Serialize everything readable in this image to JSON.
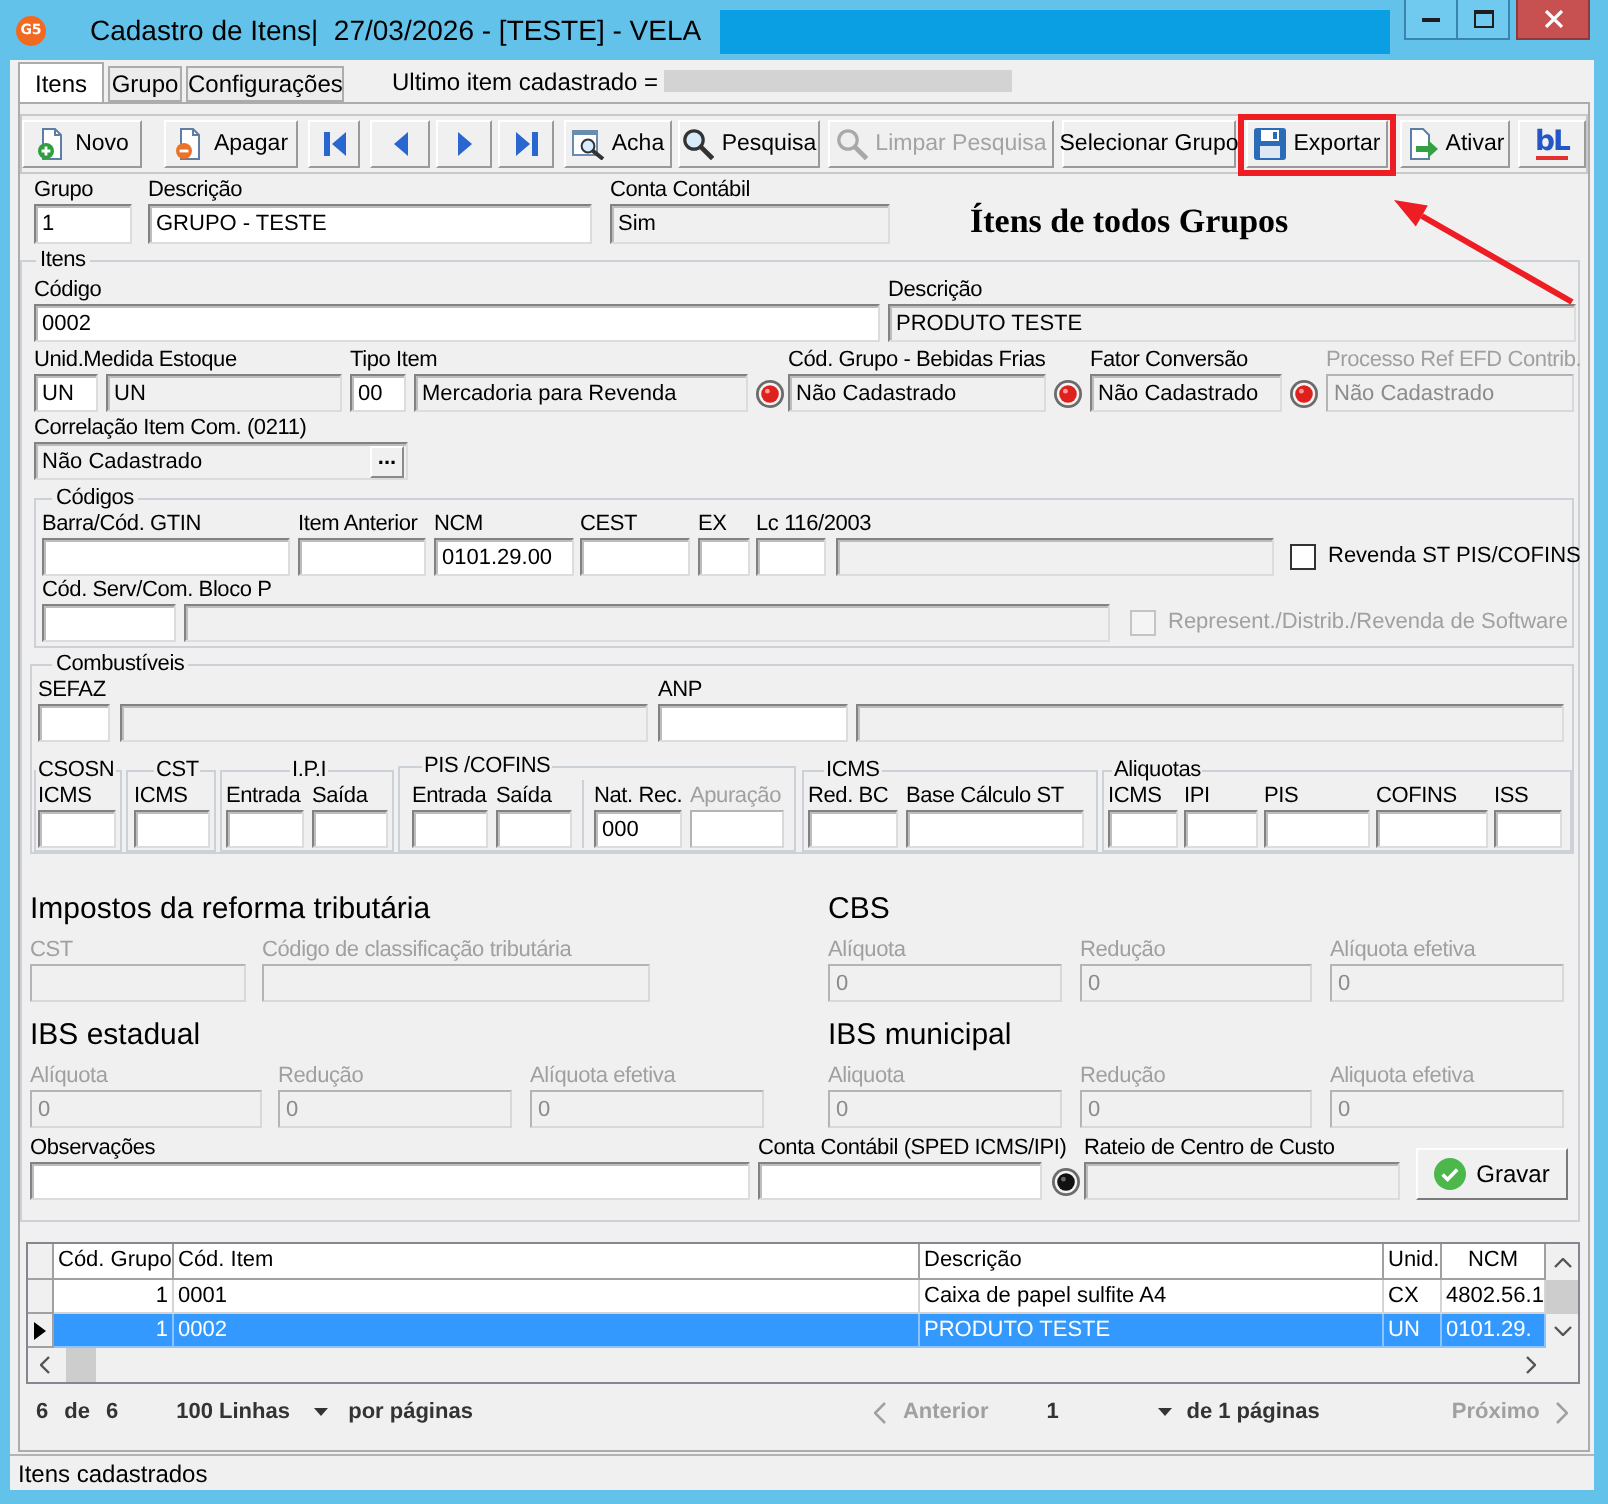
{
  "window": {
    "logo": "G5",
    "title": "Cadastro de Itens|  27/03/2026 - [TESTE] - VELA"
  },
  "tabs": [
    {
      "label": "Itens",
      "selected": true
    },
    {
      "label": "Grupo",
      "selected": false
    },
    {
      "label": "Configurações",
      "selected": false
    }
  ],
  "last_item": {
    "label": "Ultimo item cadastrado ="
  },
  "toolbar": [
    {
      "kind": "button",
      "label": "Novo",
      "disabled": false,
      "highlighted": false
    },
    {
      "kind": "button",
      "label": "Apagar",
      "disabled": false,
      "highlighted": false
    },
    {
      "kind": "nav",
      "disabled": false,
      "highlighted": false
    },
    {
      "kind": "nav",
      "disabled": false,
      "highlighted": false
    },
    {
      "kind": "nav",
      "disabled": false,
      "highlighted": false
    },
    {
      "kind": "nav",
      "disabled": false,
      "highlighted": false
    },
    {
      "kind": "button",
      "label": "Acha",
      "disabled": false,
      "highlighted": false
    },
    {
      "kind": "button",
      "label": "Pesquisa",
      "disabled": false,
      "highlighted": false
    },
    {
      "kind": "button",
      "label": "Limpar Pesquisa",
      "disabled": true,
      "highlighted": false
    },
    {
      "kind": "text",
      "label": "Selecionar Grupo",
      "disabled": false,
      "highlighted": false
    },
    {
      "kind": "button",
      "label": "Exportar",
      "disabled": false,
      "highlighted": true
    },
    {
      "kind": "button",
      "label": "Ativar",
      "disabled": false,
      "highlighted": false
    },
    {
      "kind": "logo",
      "label": "bL",
      "disabled": false,
      "highlighted": false
    }
  ],
  "annotation": {
    "note": "Ítens de todos Grupos"
  },
  "header": [
    {
      "label": "Grupo",
      "value": "1",
      "readonly": false,
      "disabled": false
    },
    {
      "label": "Descrição",
      "value": "GRUPO - TESTE",
      "readonly": false,
      "disabled": false
    },
    {
      "label": "Conta Contábil",
      "value": "Sim",
      "readonly": true,
      "disabled": false
    }
  ],
  "itens": {
    "title": "Itens",
    "row1": [
      {
        "label": "Código",
        "value": "0002",
        "readonly": false,
        "disabled": false
      },
      {
        "label": "Descrição",
        "value": "PRODUTO TESTE",
        "readonly": true,
        "disabled": false
      }
    ],
    "row2": [
      {
        "label": "Unid.Medida Estoque",
        "value": "UN",
        "readonly": false,
        "disabled": false
      },
      {
        "value": "UN",
        "readonly": true,
        "disabled": false
      },
      {
        "label": "Tipo Item",
        "value": "00",
        "readonly": false,
        "disabled": false
      },
      {
        "value": "Mercadoria para Revenda",
        "readonly": true,
        "disabled": false
      },
      {
        "label": "Cód. Grupo - Bebidas Frias",
        "value": "Não Cadastrado",
        "readonly": true,
        "disabled": false
      },
      {
        "label": "Fator Conversão",
        "value": "Não Cadastrado",
        "readonly": true,
        "disabled": false
      },
      {
        "label": "Processo Ref EFD Contrib.",
        "value": "Não Cadastrado",
        "readonly": true,
        "disabled": true
      }
    ],
    "correlation": {
      "label": "Correlação Item Com. (0211)",
      "value": "Não Cadastrado",
      "readonly": true,
      "disabled": false,
      "button": "..."
    },
    "codigos": {
      "title": "Códigos",
      "row1": [
        {
          "label": "Barra/Cód. GTIN",
          "readonly": false,
          "disabled": false
        },
        {
          "label": "Item Anterior",
          "readonly": false,
          "disabled": false
        },
        {
          "label": "NCM",
          "value": "0101.29.00",
          "readonly": false,
          "disabled": false
        },
        {
          "label": "CEST",
          "readonly": false,
          "disabled": false
        },
        {
          "label": "EX",
          "readonly": false,
          "disabled": false
        },
        {
          "label": "Lc 116/2003",
          "readonly": false,
          "disabled": false
        },
        {
          "readonly": true,
          "disabled": false
        }
      ],
      "row2": [
        {
          "label": "Cód. Serv/Com. Bloco P",
          "readonly": false,
          "disabled": false
        },
        {
          "readonly": true,
          "disabled": false
        }
      ],
      "options": [
        {
          "label": "Revenda ST PIS/COFINS",
          "checked": false,
          "disabled": false
        },
        {
          "label": "Represent./Distrib./Revenda de Software",
          "checked": false,
          "disabled": true
        }
      ]
    },
    "combustiveis": {
      "title": "Combustíveis",
      "fields": [
        {
          "label": "SEFAZ",
          "readonly": false,
          "disabled": false
        },
        {
          "readonly": true,
          "disabled": false
        },
        {
          "label": "ANP",
          "readonly": false,
          "disabled": false
        },
        {
          "readonly": true,
          "disabled": false
        }
      ],
      "groups": [
        {
          "title": "CSOSN",
          "fields": [
            {
              "label": "ICMS",
              "readonly": false,
              "disabled": false
            }
          ]
        },
        {
          "title": "CST",
          "fields": [
            {
              "label": "ICMS",
              "readonly": false,
              "disabled": false
            }
          ]
        },
        {
          "title": "I.P.I",
          "fields": [
            {
              "label": "Entrada",
              "readonly": false,
              "disabled": false
            },
            {
              "label": "Saída",
              "readonly": false,
              "disabled": false
            }
          ]
        },
        {
          "title": "PIS /COFINS",
          "fields": [
            {
              "label": "Entrada",
              "readonly": false,
              "disabled": false
            },
            {
              "label": "Saída",
              "readonly": false,
              "disabled": false
            },
            {
              "label": "Nat. Rec.",
              "value": "000",
              "readonly": false,
              "disabled": false
            },
            {
              "label": "Apuração",
              "readonly": false,
              "disabled": true
            }
          ]
        },
        {
          "title": "ICMS",
          "fields": [
            {
              "label": "Red. BC",
              "readonly": false,
              "disabled": false
            },
            {
              "label": "Base Cálculo ST",
              "readonly": false,
              "disabled": false
            }
          ]
        },
        {
          "title": "Aliquotas",
          "fields": [
            {
              "label": "ICMS",
              "readonly": false,
              "disabled": false
            },
            {
              "label": "IPI",
              "readonly": false,
              "disabled": false
            },
            {
              "label": "PIS",
              "readonly": false,
              "disabled": false
            },
            {
              "label": "COFINS",
              "readonly": false,
              "disabled": false
            },
            {
              "label": "ISS",
              "readonly": false,
              "disabled": false
            }
          ]
        }
      ]
    },
    "reforma": [
      {
        "heading": "Impostos da reforma tributária",
        "fields": [
          {
            "label": "CST",
            "readonly": true,
            "disabled": true
          },
          {
            "label": "Código de classificação tributária",
            "readonly": true,
            "disabled": true
          }
        ]
      },
      {
        "heading": "CBS",
        "fields": [
          {
            "label": "Alíquota",
            "value": "0",
            "readonly": true,
            "disabled": true
          },
          {
            "label": "Redução",
            "value": "0",
            "readonly": true,
            "disabled": true
          },
          {
            "label": "Alíquota efetiva",
            "value": "0",
            "readonly": true,
            "disabled": true
          }
        ]
      },
      {
        "heading": "IBS estadual",
        "fields": [
          {
            "label": "Alíquota",
            "value": "0",
            "readonly": true,
            "disabled": true
          },
          {
            "label": "Redução",
            "value": "0",
            "readonly": true,
            "disabled": true
          },
          {
            "label": "Alíquota efetiva",
            "value": "0",
            "readonly": true,
            "disabled": true
          }
        ]
      },
      {
        "heading": "IBS municipal",
        "fields": [
          {
            "label": "Aliquota",
            "value": "0",
            "readonly": true,
            "disabled": true
          },
          {
            "label": "Redução",
            "value": "0",
            "readonly": true,
            "disabled": true
          },
          {
            "label": "Aliquota efetiva",
            "value": "0",
            "readonly": true,
            "disabled": true
          }
        ]
      }
    ],
    "footer": {
      "fields": [
        {
          "label": "Observações",
          "readonly": false,
          "disabled": false
        },
        {
          "label": "Conta Contábil (SPED ICMS/IPI)",
          "readonly": false,
          "disabled": false
        },
        {
          "label": "Rateio de Centro de Custo",
          "readonly": true,
          "disabled": false
        }
      ],
      "save": "Gravar"
    }
  },
  "grid": {
    "columns": [
      "Cód. Grupo",
      "Cód. Item",
      "Descrição",
      "Unid.",
      "NCM"
    ],
    "rows": [
      {
        "cells": [
          "1",
          "0001",
          "Caixa de papel sulfite A4",
          "CX",
          "4802.56.1"
        ],
        "selected": false
      },
      {
        "cells": [
          "1",
          "0002",
          "PRODUTO TESTE",
          "UN",
          "0101.29."
        ],
        "selected": true
      }
    ]
  },
  "pager": {
    "count": "6",
    "of": "de",
    "total": "6",
    "page_size": "100 Linhas",
    "per_page": "por páginas",
    "previous": {
      "label": "Anterior",
      "disabled": true
    },
    "page": "1",
    "pages": "de 1 páginas",
    "next": {
      "label": "Próximo",
      "disabled": true
    }
  },
  "status_bar": "Itens cadastrados"
}
